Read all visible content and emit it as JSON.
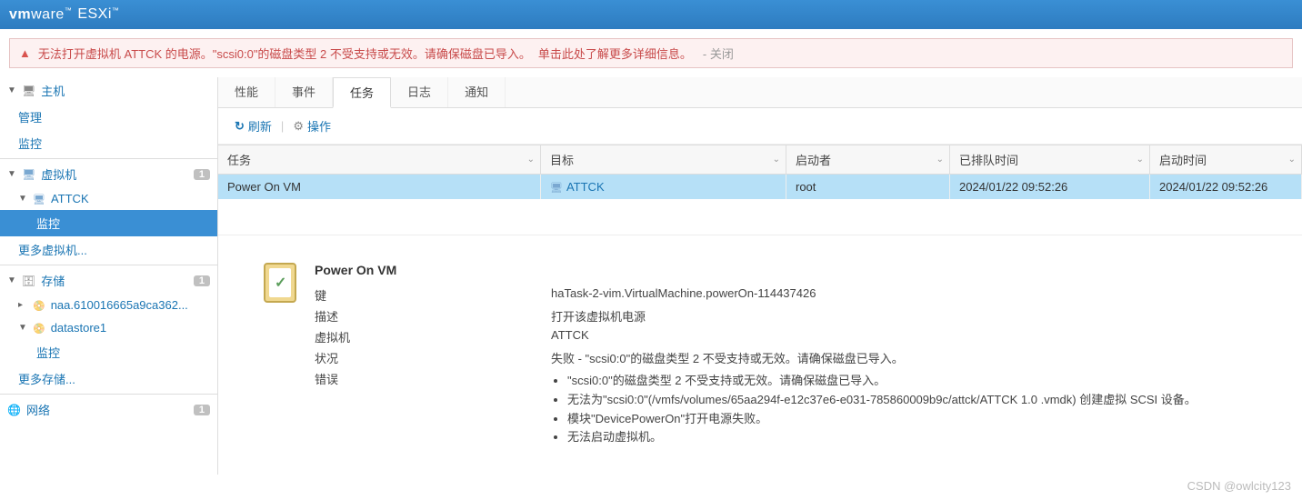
{
  "header": {
    "brand_prefix": "vm",
    "brand_suffix": "ware",
    "product": "ESXi",
    "tm": "™"
  },
  "alert": {
    "text_prefix": "无法打开虚拟机 ATTCK 的电源。\"scsi0:0\"的磁盘类型 2 不受支持或无效。请确保磁盘已导入。",
    "more_link": "单击此处了解更多详细信息。",
    "close": "- 关闭"
  },
  "sidebar": {
    "host": {
      "label": "主机",
      "manage": "管理",
      "monitor": "监控"
    },
    "vm": {
      "label": "虚拟机",
      "badge": "1",
      "item": "ATTCK",
      "monitor": "监控",
      "more": "更多虚拟机..."
    },
    "storage": {
      "label": "存储",
      "badge": "1",
      "ds1": "naa.610016665a9ca362...",
      "ds2": "datastore1",
      "monitor": "监控",
      "more": "更多存储..."
    },
    "network": {
      "label": "网络",
      "badge": "1"
    }
  },
  "tabs": [
    "性能",
    "事件",
    "任务",
    "日志",
    "通知"
  ],
  "active_tab": 2,
  "toolbar": {
    "refresh": "刷新",
    "actions": "操作"
  },
  "grid": {
    "cols": {
      "task": "任务",
      "target": "目标",
      "initiator": "启动者",
      "queued": "已排队时间",
      "start": "启动时间"
    },
    "rows": [
      {
        "task": "Power On VM",
        "target": "ATTCK",
        "initiator": "root",
        "queued": "2024/01/22 09:52:26",
        "start": "2024/01/22 09:52:26"
      }
    ]
  },
  "detail": {
    "title": "Power On VM",
    "labels": {
      "key": "键",
      "desc": "描述",
      "vm": "虚拟机",
      "status": "状况",
      "errors": "错误"
    },
    "key": "haTask-2-vim.VirtualMachine.powerOn-114437426",
    "desc": "打开该虚拟机电源",
    "vm": "ATTCK",
    "status": "失败 - \"scsi0:0\"的磁盘类型 2 不受支持或无效。请确保磁盘已导入。",
    "errors": [
      "\"scsi0:0\"的磁盘类型 2 不受支持或无效。请确保磁盘已导入。",
      "无法为\"scsi0:0\"(/vmfs/volumes/65aa294f-e12c37e6-e031-785860009b9c/attck/ATTCK 1.0 .vmdk) 创建虚拟 SCSI 设备。",
      "模块\"DevicePowerOn\"打开电源失败。",
      "无法启动虚拟机。"
    ]
  },
  "watermark": "CSDN @owlcity123"
}
